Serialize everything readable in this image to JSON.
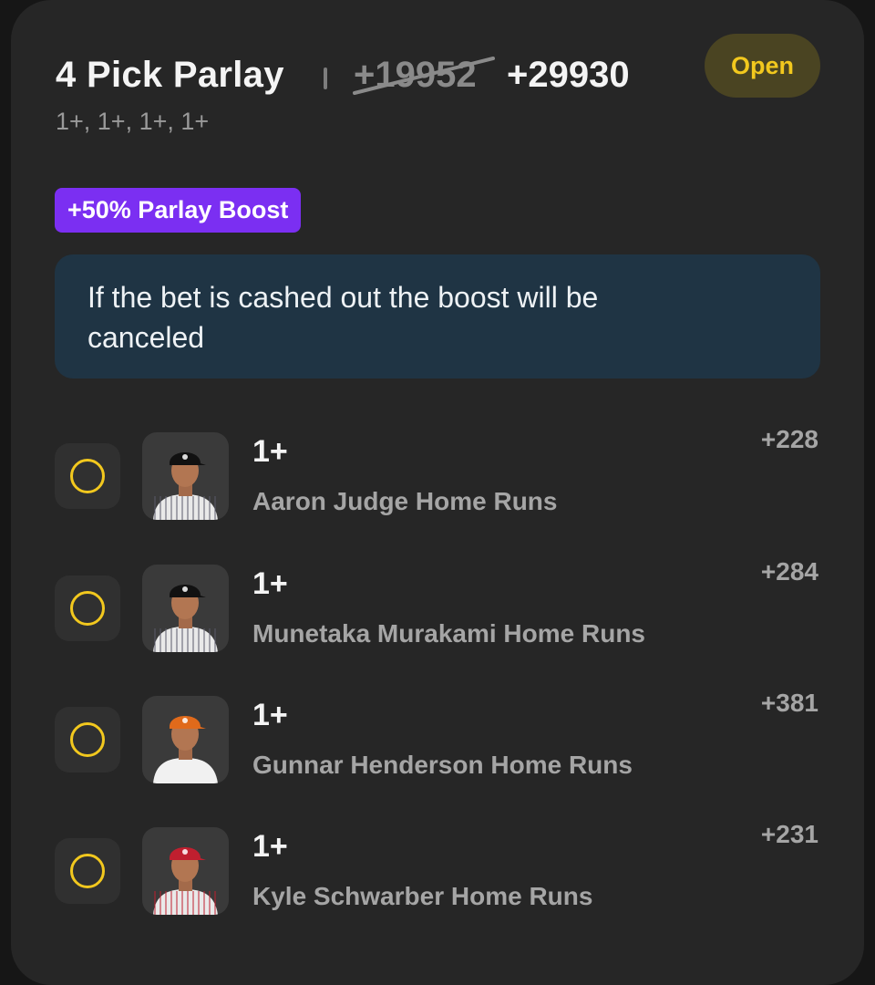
{
  "bet": {
    "title": "4 Pick Parlay",
    "original_odds": "+19952",
    "boosted_odds": "+29930",
    "status": "Open",
    "lines_summary": "1+, 1+, 1+, 1+",
    "boost_label": "+50% Parlay Boost",
    "notice": "If the bet is cashed out the boost will be canceled"
  },
  "picks": [
    {
      "line": "1+",
      "player": "Aaron Judge Home Runs",
      "odds": "+228",
      "cap_color": "#111111",
      "jersey": "pinstripe-gray"
    },
    {
      "line": "1+",
      "player": "Munetaka Murakami Home Runs",
      "odds": "+284",
      "cap_color": "#111111",
      "jersey": "pinstripe-white"
    },
    {
      "line": "1+",
      "player": "Gunnar Henderson Home Runs",
      "odds": "+381",
      "cap_color": "#e06a1b",
      "jersey": "white"
    },
    {
      "line": "1+",
      "player": "Kyle Schwarber Home Runs",
      "odds": "+231",
      "cap_color": "#c01f2f",
      "jersey": "pinstripe-red"
    }
  ],
  "colors": {
    "accent": "#f2c81e",
    "boost": "#7b2ff2",
    "notice_bg": "#1f3444",
    "card_bg": "#262626"
  }
}
